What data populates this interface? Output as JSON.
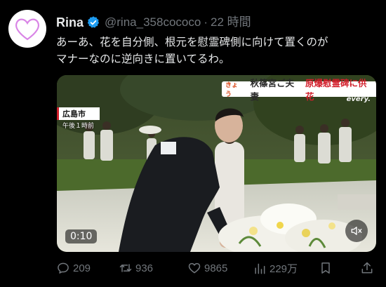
{
  "author": {
    "name": "Rina",
    "handle": "@rina_358cococo",
    "separator": "·",
    "time": "22 時間",
    "verified": true,
    "avatar_icon": "heart-icon"
  },
  "post": {
    "lines": [
      "あーあ、花を自分側、根元を慰霊碑側に向けて置くのが",
      "マナーなのに逆向きに置いてるわ。"
    ]
  },
  "video": {
    "caption_tag": "きょう",
    "caption_main": "秋篠宮ご夫妻",
    "caption_sub": "原爆慰霊碑に供花",
    "network": "every.",
    "location": "広島市",
    "location_time": "午後１時前",
    "timestamp": "0:10",
    "mute_icon": "volume-muted-icon"
  },
  "actions": {
    "replies": "209",
    "reposts": "936",
    "likes": "9865",
    "views": "229万"
  },
  "colors": {
    "background": "#000000",
    "text": "#e7e9ea",
    "muted": "#71767b",
    "verified": "#1d9bf0",
    "avatar_heart": "#d985e6",
    "caption_red": "#d21f2b"
  }
}
